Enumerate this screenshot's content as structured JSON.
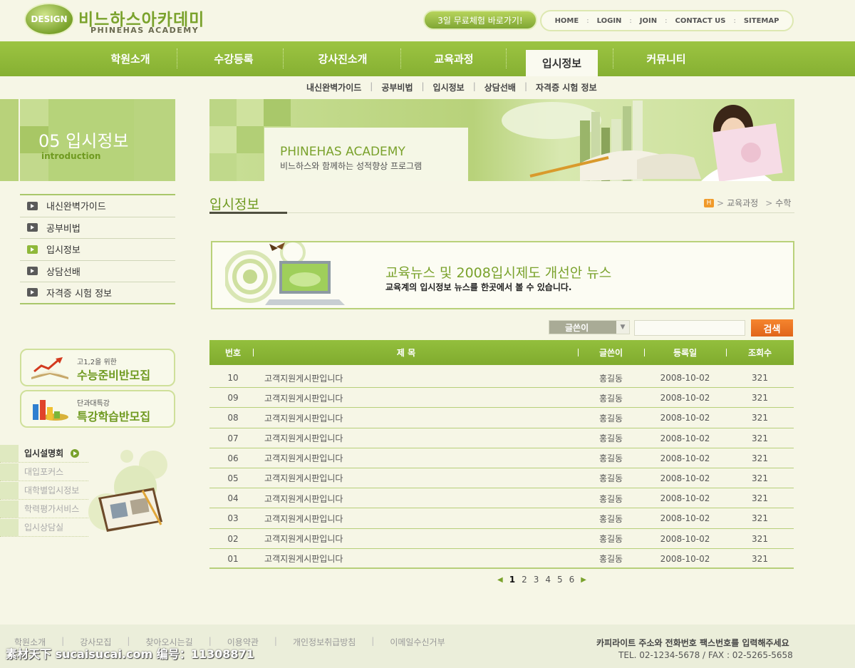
{
  "brand": {
    "badge": "DESIGN",
    "name_ko": "비느하스아카데미",
    "name_en": "PHINEHAS ACADEMY"
  },
  "trial_button": "3일 무료체험 바로가기!",
  "util_nav": [
    "HOME",
    "LOGIN",
    "JOIN",
    "CONTACT US",
    "SITEMAP"
  ],
  "util_sep": ":",
  "gnb": [
    "학원소개",
    "수강등록",
    "강사진소개",
    "교육과정",
    "입시정보",
    "커뮤니티"
  ],
  "gnb_active": 4,
  "sub_nav": [
    "내신완벽가이드",
    "공부비법",
    "입시정보",
    "상담선배",
    "자격증 시험 정보"
  ],
  "sub_sep": "|",
  "left_title": {
    "main": "05 입시정보",
    "sub": "introduction"
  },
  "banner": {
    "title": "PHINEHAS ACADEMY",
    "subtitle": "비느하스와 함께하는 성적향상 프로그램"
  },
  "left_menu": [
    "내신완벽가이드",
    "공부비법",
    "입시정보",
    "상담선배",
    "자격증 시험 정보"
  ],
  "left_menu_active": 2,
  "promos": [
    {
      "small": "고1,2을 위한",
      "big": "수능준비반모집"
    },
    {
      "small": "단과대특강",
      "big": "특강학습반모집"
    }
  ],
  "quick_links": [
    "입시설명회",
    "대입포커스",
    "대학별입시정보",
    "학력평가서비스",
    "입시상담실"
  ],
  "quick_active": 0,
  "page_title": "입시정보",
  "breadcrumb": {
    "home": "H",
    "items": [
      "교육과정",
      "수학"
    ],
    "sep": ">"
  },
  "news": {
    "title": "교육뉴스 및 2008입시제도 개선안 뉴스",
    "desc": "교육계의 입시정보 뉴스를 한곳에서 볼 수 있습니다."
  },
  "search": {
    "select_value": "글쓴이",
    "placeholder": "",
    "button": "검색"
  },
  "table": {
    "headers": [
      "번호",
      "제 목",
      "글쓴이",
      "등록일",
      "조회수"
    ],
    "rows": [
      {
        "no": "10",
        "title": "고객지원게시판입니다",
        "author": "홍길동",
        "date": "2008-10-02",
        "views": "321"
      },
      {
        "no": "09",
        "title": "고객지원게시판입니다",
        "author": "홍길동",
        "date": "2008-10-02",
        "views": "321"
      },
      {
        "no": "08",
        "title": "고객지원게시판입니다",
        "author": "홍길동",
        "date": "2008-10-02",
        "views": "321"
      },
      {
        "no": "07",
        "title": "고객지원게시판입니다",
        "author": "홍길동",
        "date": "2008-10-02",
        "views": "321"
      },
      {
        "no": "06",
        "title": "고객지원게시판입니다",
        "author": "홍길동",
        "date": "2008-10-02",
        "views": "321"
      },
      {
        "no": "05",
        "title": "고객지원게시판입니다",
        "author": "홍길동",
        "date": "2008-10-02",
        "views": "321"
      },
      {
        "no": "04",
        "title": "고객지원게시판입니다",
        "author": "홍길동",
        "date": "2008-10-02",
        "views": "321"
      },
      {
        "no": "03",
        "title": "고객지원게시판입니다",
        "author": "홍길동",
        "date": "2008-10-02",
        "views": "321"
      },
      {
        "no": "02",
        "title": "고객지원게시판입니다",
        "author": "홍길동",
        "date": "2008-10-02",
        "views": "321"
      },
      {
        "no": "01",
        "title": "고객지원게시판입니다",
        "author": "홍길동",
        "date": "2008-10-02",
        "views": "321"
      }
    ]
  },
  "pager": {
    "prev": "◀",
    "next": "▶",
    "pages": [
      "1",
      "2",
      "3",
      "4",
      "5",
      "6"
    ],
    "current": 0
  },
  "footer": {
    "nav": [
      "학원소개",
      "강사모집",
      "찾아오시는길",
      "이용약관",
      "개인정보취급방침",
      "이메일수신거부"
    ],
    "sep": "|",
    "copy": "카피라이트 주소와 전화번호 팩스번호를 입력해주세요",
    "tel": "TEL. 02-1234-5678 / FAX : 02-5265-5658"
  },
  "watermark": "素材天下 sucaisucai.com  编号：11308871",
  "colors": {
    "brand_green": "#8db83a",
    "accent_orange": "#e97a22",
    "background": "#f6f6e6"
  }
}
